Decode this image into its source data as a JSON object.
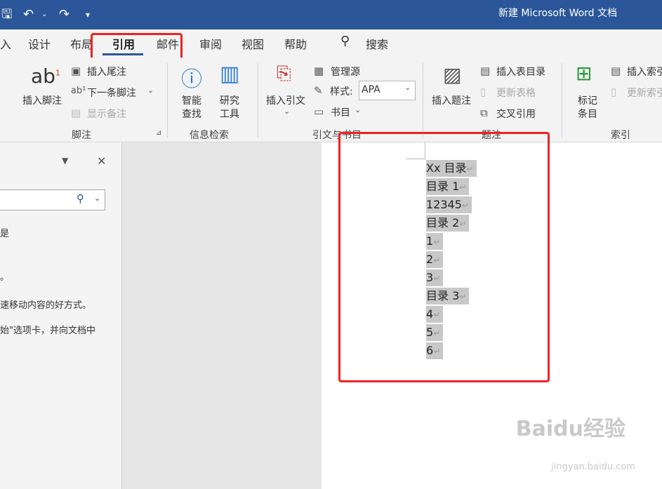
{
  "titlebar": {
    "title": "新建 Microsoft Word 文档",
    "icons": [
      "save-icon",
      "undo-icon",
      "redo-icon",
      "customize-icon"
    ]
  },
  "tabs": [
    {
      "label": "入"
    },
    {
      "label": "设计"
    },
    {
      "label": "布局"
    },
    {
      "label": "引用",
      "active": true
    },
    {
      "label": "邮件"
    },
    {
      "label": "审阅"
    },
    {
      "label": "视图"
    },
    {
      "label": "帮助"
    },
    {
      "label": "搜索"
    }
  ],
  "ribbon": {
    "footnotes": {
      "insert_footnote": "插入脚注",
      "insert_endnote": "插入尾注",
      "next_footnote": "下一条脚注",
      "show_notes": "显示备注",
      "group": "脚注",
      "ab_glyph": "ab",
      "ab_sup": "1"
    },
    "research": {
      "smart_lookup": "智能",
      "smart_lookup_2": "查找",
      "research": "研究",
      "research_2": "工具",
      "group": "信息检索"
    },
    "citations": {
      "insert_citation": "插入引文",
      "manage_sources": "管理源",
      "style_label": "样式:",
      "style_value": "APA",
      "bibliography": "书目",
      "group": "引文与书目"
    },
    "captions": {
      "insert_caption": "插入题注",
      "insert_table_of_figures": "插入表目录",
      "update_table": "更新表格",
      "cross_reference": "交叉引用",
      "group": "题注"
    },
    "index": {
      "mark_entry": "标记",
      "mark_entry_2": "条目",
      "insert_index": "插入索引",
      "update_index": "更新索引",
      "group": "索引"
    }
  },
  "nav_pane": {
    "lines": [
      "是",
      "。",
      "速移动内容的好方式。",
      "始\"选项卡，并向文档中"
    ]
  },
  "document": {
    "lines": [
      "Xx 目录",
      "目录 1",
      "12345",
      "目录 2",
      "1",
      "2",
      "3",
      "目录 3",
      "4",
      "5",
      "6"
    ],
    "para_mark": "↵"
  },
  "watermark": {
    "text": "Baidu经验",
    "sub": "jingyan.baidu.com"
  }
}
